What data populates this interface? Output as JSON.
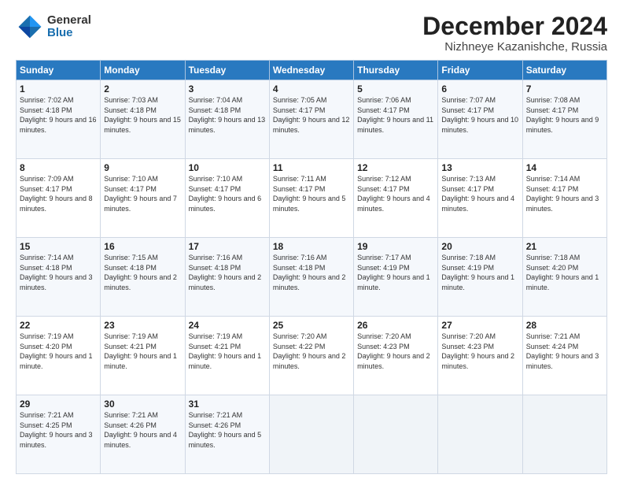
{
  "logo": {
    "general": "General",
    "blue": "Blue"
  },
  "header": {
    "month": "December 2024",
    "location": "Nizhneye Kazanishche, Russia"
  },
  "days_of_week": [
    "Sunday",
    "Monday",
    "Tuesday",
    "Wednesday",
    "Thursday",
    "Friday",
    "Saturday"
  ],
  "weeks": [
    [
      {
        "day": "1",
        "sunrise": "7:02 AM",
        "sunset": "4:18 PM",
        "daylight": "9 hours and 16 minutes."
      },
      {
        "day": "2",
        "sunrise": "7:03 AM",
        "sunset": "4:18 PM",
        "daylight": "9 hours and 15 minutes."
      },
      {
        "day": "3",
        "sunrise": "7:04 AM",
        "sunset": "4:18 PM",
        "daylight": "9 hours and 13 minutes."
      },
      {
        "day": "4",
        "sunrise": "7:05 AM",
        "sunset": "4:17 PM",
        "daylight": "9 hours and 12 minutes."
      },
      {
        "day": "5",
        "sunrise": "7:06 AM",
        "sunset": "4:17 PM",
        "daylight": "9 hours and 11 minutes."
      },
      {
        "day": "6",
        "sunrise": "7:07 AM",
        "sunset": "4:17 PM",
        "daylight": "9 hours and 10 minutes."
      },
      {
        "day": "7",
        "sunrise": "7:08 AM",
        "sunset": "4:17 PM",
        "daylight": "9 hours and 9 minutes."
      }
    ],
    [
      {
        "day": "8",
        "sunrise": "7:09 AM",
        "sunset": "4:17 PM",
        "daylight": "9 hours and 8 minutes."
      },
      {
        "day": "9",
        "sunrise": "7:10 AM",
        "sunset": "4:17 PM",
        "daylight": "9 hours and 7 minutes."
      },
      {
        "day": "10",
        "sunrise": "7:10 AM",
        "sunset": "4:17 PM",
        "daylight": "9 hours and 6 minutes."
      },
      {
        "day": "11",
        "sunrise": "7:11 AM",
        "sunset": "4:17 PM",
        "daylight": "9 hours and 5 minutes."
      },
      {
        "day": "12",
        "sunrise": "7:12 AM",
        "sunset": "4:17 PM",
        "daylight": "9 hours and 4 minutes."
      },
      {
        "day": "13",
        "sunrise": "7:13 AM",
        "sunset": "4:17 PM",
        "daylight": "9 hours and 4 minutes."
      },
      {
        "day": "14",
        "sunrise": "7:14 AM",
        "sunset": "4:17 PM",
        "daylight": "9 hours and 3 minutes."
      }
    ],
    [
      {
        "day": "15",
        "sunrise": "7:14 AM",
        "sunset": "4:18 PM",
        "daylight": "9 hours and 3 minutes."
      },
      {
        "day": "16",
        "sunrise": "7:15 AM",
        "sunset": "4:18 PM",
        "daylight": "9 hours and 2 minutes."
      },
      {
        "day": "17",
        "sunrise": "7:16 AM",
        "sunset": "4:18 PM",
        "daylight": "9 hours and 2 minutes."
      },
      {
        "day": "18",
        "sunrise": "7:16 AM",
        "sunset": "4:18 PM",
        "daylight": "9 hours and 2 minutes."
      },
      {
        "day": "19",
        "sunrise": "7:17 AM",
        "sunset": "4:19 PM",
        "daylight": "9 hours and 1 minute."
      },
      {
        "day": "20",
        "sunrise": "7:18 AM",
        "sunset": "4:19 PM",
        "daylight": "9 hours and 1 minute."
      },
      {
        "day": "21",
        "sunrise": "7:18 AM",
        "sunset": "4:20 PM",
        "daylight": "9 hours and 1 minute."
      }
    ],
    [
      {
        "day": "22",
        "sunrise": "7:19 AM",
        "sunset": "4:20 PM",
        "daylight": "9 hours and 1 minute."
      },
      {
        "day": "23",
        "sunrise": "7:19 AM",
        "sunset": "4:21 PM",
        "daylight": "9 hours and 1 minute."
      },
      {
        "day": "24",
        "sunrise": "7:19 AM",
        "sunset": "4:21 PM",
        "daylight": "9 hours and 1 minute."
      },
      {
        "day": "25",
        "sunrise": "7:20 AM",
        "sunset": "4:22 PM",
        "daylight": "9 hours and 2 minutes."
      },
      {
        "day": "26",
        "sunrise": "7:20 AM",
        "sunset": "4:23 PM",
        "daylight": "9 hours and 2 minutes."
      },
      {
        "day": "27",
        "sunrise": "7:20 AM",
        "sunset": "4:23 PM",
        "daylight": "9 hours and 2 minutes."
      },
      {
        "day": "28",
        "sunrise": "7:21 AM",
        "sunset": "4:24 PM",
        "daylight": "9 hours and 3 minutes."
      }
    ],
    [
      {
        "day": "29",
        "sunrise": "7:21 AM",
        "sunset": "4:25 PM",
        "daylight": "9 hours and 3 minutes."
      },
      {
        "day": "30",
        "sunrise": "7:21 AM",
        "sunset": "4:26 PM",
        "daylight": "9 hours and 4 minutes."
      },
      {
        "day": "31",
        "sunrise": "7:21 AM",
        "sunset": "4:26 PM",
        "daylight": "9 hours and 5 minutes."
      },
      null,
      null,
      null,
      null
    ]
  ],
  "labels": {
    "sunrise": "Sunrise:",
    "sunset": "Sunset:",
    "daylight": "Daylight:"
  }
}
